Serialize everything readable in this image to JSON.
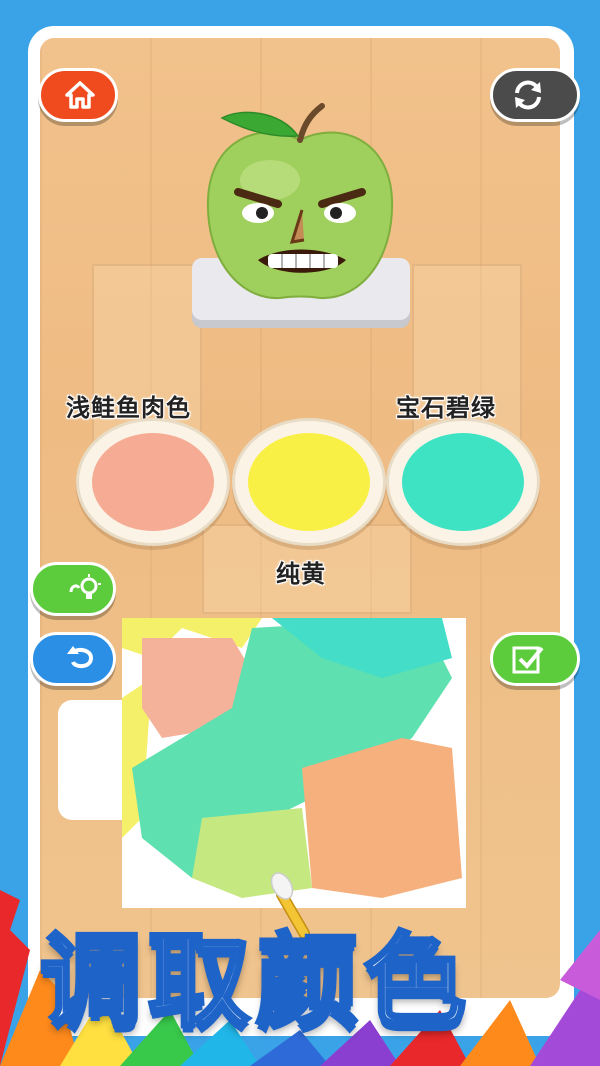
{
  "toolbar": {
    "home_icon": "home-icon",
    "refresh_icon": "refresh-icon",
    "hint_icon": "lightbulb-icon",
    "undo_icon": "undo-icon",
    "confirm_icon": "checkbox-icon"
  },
  "character": {
    "name": "angry-green-apple"
  },
  "swatches": [
    {
      "label": "浅鲑鱼肉色",
      "color": "#f6ab94"
    },
    {
      "label": "纯黄",
      "color": "#f9f046"
    },
    {
      "label": "宝石碧绿",
      "color": "#3ee3c4"
    }
  ],
  "banner": {
    "title": "调取颜色"
  },
  "colors": {
    "background": "#3aa3e8",
    "home": "#ef4b1e",
    "refresh": "#4b4b4b",
    "green_button": "#5ccc3c",
    "blue_button": "#2b8fe6"
  }
}
